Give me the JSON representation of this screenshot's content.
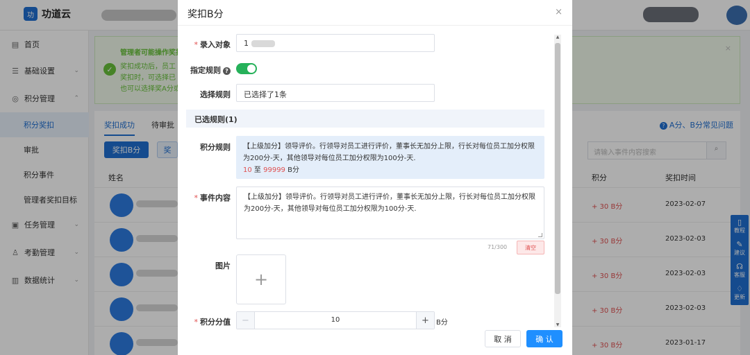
{
  "app": {
    "logo_mark": "功",
    "name": "功道云"
  },
  "sidebar": {
    "items": [
      {
        "icon": "home-icon",
        "glyph": "▤",
        "label": "首页"
      },
      {
        "icon": "settings-icon",
        "glyph": "☰",
        "label": "基础设置"
      },
      {
        "icon": "points-icon",
        "glyph": "◎",
        "label": "积分管理"
      },
      {
        "label": "积分奖扣"
      },
      {
        "label": "审批"
      },
      {
        "label": "积分事件"
      },
      {
        "label": "管理者奖扣目标"
      },
      {
        "icon": "task-icon",
        "glyph": "▣",
        "label": "任务管理"
      },
      {
        "icon": "attendance-icon",
        "glyph": "♙",
        "label": "考勤管理"
      },
      {
        "icon": "stats-icon",
        "glyph": "▥",
        "label": "数据统计"
      }
    ],
    "chevron": "⌄",
    "chevron_up": "⌃"
  },
  "alert": {
    "title": "管理者可能操作奖扣",
    "line1": "奖扣成功后，员工",
    "line2": "奖扣时，可选择已",
    "line3": "也可以选择奖A分或",
    "check": "✓",
    "close": "×"
  },
  "panel": {
    "tabs": [
      "奖扣成功",
      "待审批"
    ],
    "help": "A分、B分常见问题",
    "help_icon": "?",
    "btn_primary": "奖扣B分",
    "btn_secondary": "奖",
    "search_placeholder": "请输入事件内容搜索",
    "search_icon": "⌕",
    "col_name": "姓名",
    "col_points": "积分",
    "col_time": "奖扣时间",
    "rows": [
      {
        "points": "+ 30 B分",
        "date": "2023-02-07"
      },
      {
        "points": "+ 30 B分",
        "date": "2023-02-03"
      },
      {
        "points": "+ 30 B分",
        "date": "2023-02-03"
      },
      {
        "points": "+ 30 B分",
        "date": "2023-02-03"
      },
      {
        "points": "+ 30 B分",
        "date": "2023-01-17"
      }
    ]
  },
  "float_tools": [
    {
      "icon": "tutorial-icon",
      "glyph": "▯",
      "label": "教程"
    },
    {
      "icon": "suggest-icon",
      "glyph": "✎",
      "label": "建议"
    },
    {
      "icon": "service-icon",
      "glyph": "☊",
      "label": "客服"
    },
    {
      "icon": "update-icon",
      "glyph": "♢",
      "label": "更新"
    }
  ],
  "dialog": {
    "title": "奖扣B分",
    "close": "×",
    "target_label": "录入对象",
    "target_value": "1",
    "rule_toggle_label": "指定规则",
    "rule_toggle_on": true,
    "select_rule_label": "选择规则",
    "select_rule_value": "已选择了1条",
    "selected_header": "已选规则(1)",
    "rule_label": "积分规则",
    "rule_text": "【上级加分】领导评价。行领导对员工进行评价，董事长无加分上限，行长对每位员工加分权限为200分-天，其他领导对每位员工加分权限为100分-天.",
    "rule_min": "10",
    "rule_to": "至",
    "rule_max": "99999",
    "rule_unit": "B分",
    "event_label": "事件内容",
    "event_text": "【上级加分】领导评价。行领导对员工进行评价，董事长无加分上限，行长对每位员工加分权限为200分-天，其他领导对每位员工加分权限为100分-天.",
    "counter": "71/300",
    "clear": "清空",
    "image_label": "图片",
    "upload_glyph": "+",
    "score_label": "积分分值",
    "score_value": "10",
    "score_unit": "B分",
    "minus": "−",
    "plus": "+",
    "cancel": "取 消",
    "confirm": "确 认",
    "required_mark": "*"
  },
  "colors": {
    "accent": "#1f6fd1",
    "toggle_on": "#26b15a",
    "danger": "#e05050",
    "confirm": "#1f8fff"
  }
}
